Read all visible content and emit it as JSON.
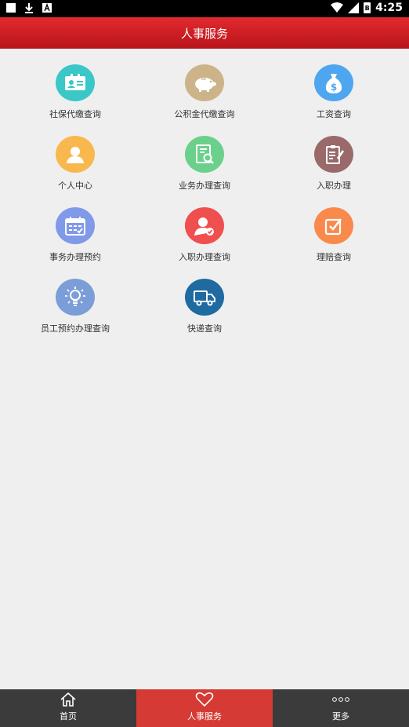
{
  "status_bar": {
    "time": "4:25",
    "battery_label": "B"
  },
  "header": {
    "title": "人事服务"
  },
  "grid": {
    "items": [
      {
        "label": "社保代缴查询",
        "icon": "id-card-icon",
        "color": "#39c7c7"
      },
      {
        "label": "公积金代缴查询",
        "icon": "piggy-bank-icon",
        "color": "#cdb38a"
      },
      {
        "label": "工资查询",
        "icon": "money-bag-icon",
        "color": "#4ea6f0"
      },
      {
        "label": "个人中心",
        "icon": "person-icon",
        "color": "#f8b84e"
      },
      {
        "label": "业务办理查询",
        "icon": "document-search-icon",
        "color": "#6bd08b"
      },
      {
        "label": "入职办理",
        "icon": "clipboard-edit-icon",
        "color": "#9a6a6a"
      },
      {
        "label": "事务办理预约",
        "icon": "calendar-icon",
        "color": "#8099e8"
      },
      {
        "label": "入职办理查询",
        "icon": "user-check-icon",
        "color": "#ef4f4f"
      },
      {
        "label": "理赔查询",
        "icon": "checkbox-icon",
        "color": "#f98a4c"
      },
      {
        "label": "员工预约办理查询",
        "icon": "lightbulb-icon",
        "color": "#7b9ed8"
      },
      {
        "label": "快递查询",
        "icon": "truck-icon",
        "color": "#1f6aa0"
      }
    ]
  },
  "tabbar": {
    "tabs": [
      {
        "label": "首页",
        "icon": "home-icon",
        "active": false
      },
      {
        "label": "人事服务",
        "icon": "heart-icon",
        "active": true
      },
      {
        "label": "更多",
        "icon": "more-dots-icon",
        "active": false
      }
    ],
    "active_color": "#d63a34"
  }
}
